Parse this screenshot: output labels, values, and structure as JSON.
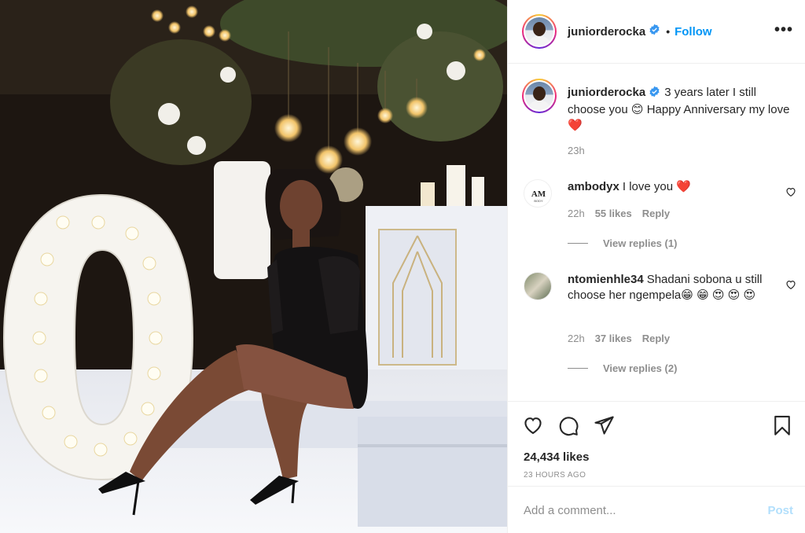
{
  "header": {
    "username": "juniorderocka",
    "separator": "•",
    "follow_label": "Follow",
    "more_icon": "more-options-icon"
  },
  "caption": {
    "username": "juniorderocka",
    "text": "3 years later I still choose you 😊 Happy Anniversary my love ❤️",
    "time": "23h"
  },
  "comments": [
    {
      "username": "ambodyx",
      "text": "I love you ❤️",
      "time": "22h",
      "likes": "55 likes",
      "reply_label": "Reply",
      "view_replies": "View replies (1)",
      "avatar_text": "AM"
    },
    {
      "username": "ntomienhle34",
      "text": "Shadani sobona u still choose her ngempela😁 😁 😍 😍 😍",
      "time": "22h",
      "likes": "37 likes",
      "reply_label": "Reply",
      "view_replies": "View replies (2)"
    }
  ],
  "actions": {
    "like_icon": "heart-icon",
    "comment_icon": "comment-icon",
    "share_icon": "share-icon",
    "save_icon": "bookmark-icon",
    "likes_count": "24,434 likes",
    "posted_ago": "23 HOURS AGO"
  },
  "add_comment": {
    "placeholder": "Add a comment...",
    "post_label": "Post"
  },
  "colors": {
    "link_blue": "#0095f6",
    "post_disabled": "#b2dffc",
    "verified_blue": "#3897f0",
    "heart_red": "#ed4956"
  }
}
